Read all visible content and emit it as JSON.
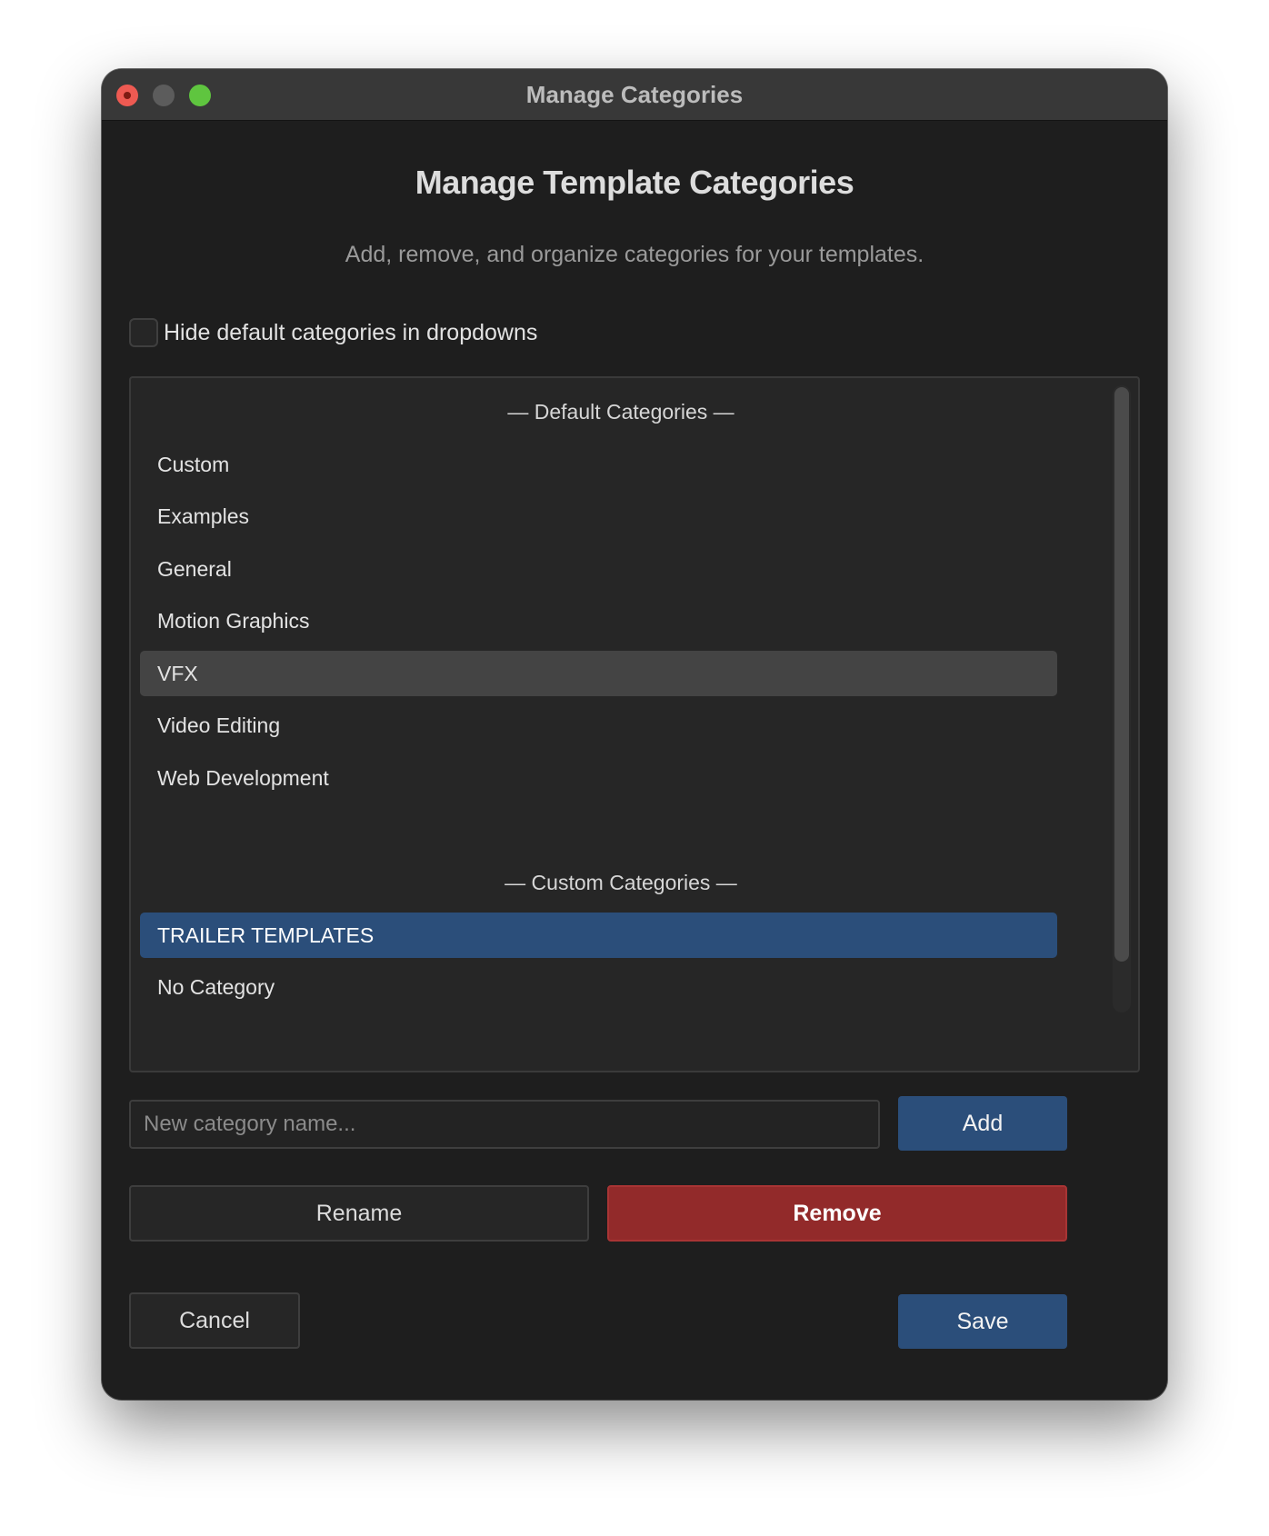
{
  "window": {
    "title": "Manage Categories"
  },
  "dialog": {
    "heading": "Manage Template Categories",
    "subtitle": "Add, remove, and organize categories for your templates.",
    "hide_defaults_label": "Hide default categories in dropdowns",
    "hide_defaults_checked": false
  },
  "list": {
    "default_header": "— Default Categories —",
    "default_items": [
      "Custom",
      "Examples",
      "General",
      "Motion Graphics",
      "VFX",
      "Video Editing",
      "Web Development"
    ],
    "hovered_item": "VFX",
    "custom_header": "— Custom Categories —",
    "custom_items": [
      "TRAILER TEMPLATES",
      "No Category"
    ],
    "selected_item": "TRAILER TEMPLATES"
  },
  "new_category": {
    "placeholder": "New category name...",
    "value": ""
  },
  "buttons": {
    "add": "Add",
    "rename": "Rename",
    "remove": "Remove",
    "cancel": "Cancel",
    "save": "Save"
  },
  "colors": {
    "primary": "#2b4e7a",
    "danger": "#922a2a",
    "background": "#1e1e1e"
  }
}
